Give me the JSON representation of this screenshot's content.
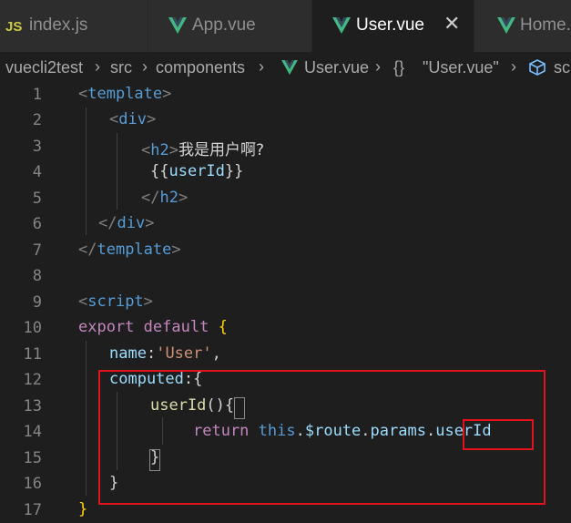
{
  "tabs": [
    {
      "icon": "JS",
      "label": "index.js"
    },
    {
      "label": "App.vue"
    },
    {
      "label": "User.vue"
    },
    {
      "label": "Home.vue"
    }
  ],
  "tab_close": "✕",
  "breadcrumb": {
    "items": [
      "vuecli2test",
      "src",
      "components",
      "User.vue",
      "\"User.vue\"",
      "sc"
    ],
    "braces": "{}"
  },
  "line_numbers": [
    "1",
    "2",
    "3",
    "4",
    "5",
    "6",
    "7",
    "8",
    "9",
    "10",
    "11",
    "12",
    "13",
    "14",
    "15",
    "16",
    "17"
  ],
  "code": {
    "l1_open": "<",
    "l1_tag": "template",
    "l1_close": ">",
    "l2_open": "<",
    "l2_tag": "div",
    "l2_close": ">",
    "l3_open": "<",
    "l3_tag": "h2",
    "l3_close": ">",
    "l3_text": "我是用户啊?",
    "l4_text": "{{",
    "l4_var": "userId",
    "l4_end": "}}",
    "l5_open": "</",
    "l5_tag": "h2",
    "l5_close": ">",
    "l6_open": "</",
    "l6_tag": "div",
    "l6_close": ">",
    "l7_open": "</",
    "l7_tag": "template",
    "l7_close": ">",
    "l9_open": "<",
    "l9_tag": "script",
    "l9_close": ">",
    "l10_export": "export",
    "l10_default": "default",
    "l10_brace": "{",
    "l11_key": "name",
    "l11_colon": ":",
    "l11_val": "'User'",
    "l11_comma": ",",
    "l12_key": "computed",
    "l12_rest": ":{",
    "l13_fn": "userId",
    "l13_paren": "()",
    "l13_brace": "{",
    "l14_return": "return",
    "l14_this": "this",
    "l14_dot1": ".",
    "l14_route": "$route",
    "l14_dot2": ".",
    "l14_params": "params",
    "l14_dot3": ".",
    "l14_userid": "userId",
    "l15_brace": "}",
    "l16_brace": "}",
    "l17_brace": "}"
  },
  "colors": {
    "editor_bg": "#1e1e1e",
    "highlight_box": "#e0121b",
    "vue_green": "#41b883"
  }
}
